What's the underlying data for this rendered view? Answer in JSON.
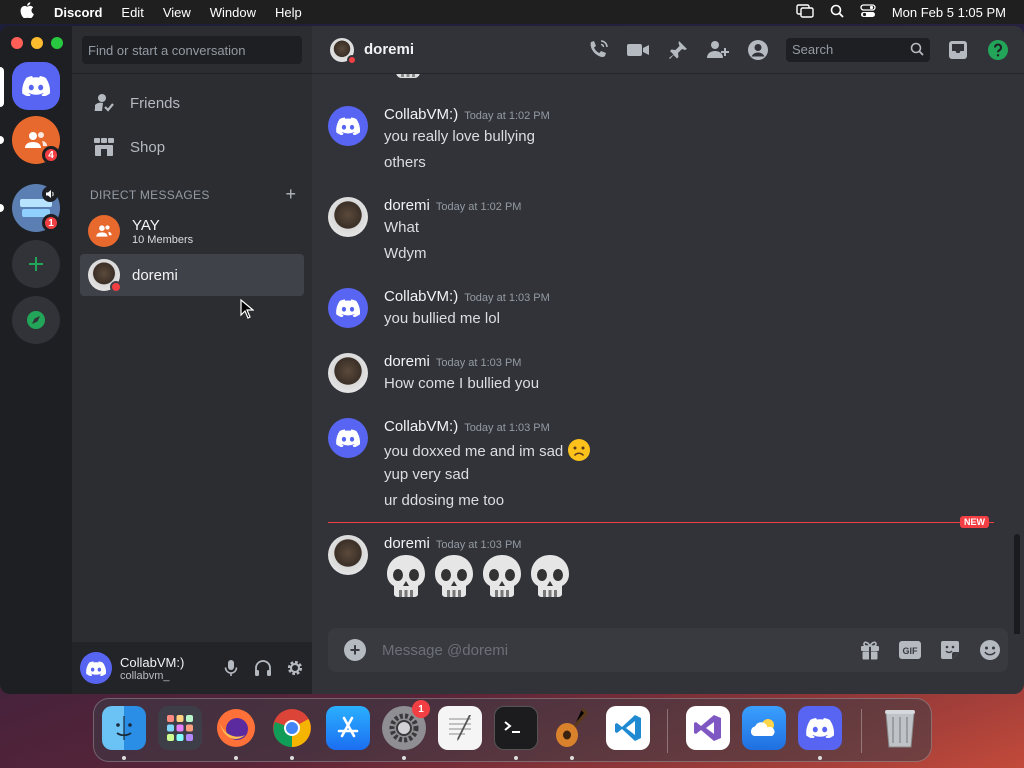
{
  "menubar": {
    "app_name": "Discord",
    "items": [
      "Edit",
      "View",
      "Window",
      "Help"
    ],
    "clock": "Mon Feb 5  1:05 PM"
  },
  "servers": {
    "friends_badge": "4",
    "server_badge": "1"
  },
  "sidebar": {
    "find_placeholder": "Find or start a conversation",
    "friends_label": "Friends",
    "shop_label": "Shop",
    "dm_header": "DIRECT MESSAGES",
    "dms": [
      {
        "name": "YAY",
        "sub": "10 Members"
      },
      {
        "name": "doremi",
        "sub": ""
      }
    ]
  },
  "user_panel": {
    "display_name": "CollabVM:)",
    "username": "collabvm_"
  },
  "topbar": {
    "channel_name": "doremi",
    "search_placeholder": "Search"
  },
  "messages": [
    {
      "author": "CollabVM:)",
      "time": "Today at 1:02 PM",
      "lines": [
        "you really love bullying",
        "others"
      ]
    },
    {
      "author": "doremi",
      "time": "Today at 1:02 PM",
      "lines": [
        "What",
        "Wdym"
      ]
    },
    {
      "author": "CollabVM:)",
      "time": "Today at 1:03 PM",
      "lines": [
        "you bullied me lol"
      ]
    },
    {
      "author": "doremi",
      "time": "Today at 1:03 PM",
      "lines": [
        "How come I bullied you"
      ]
    },
    {
      "author": "CollabVM:)",
      "time": "Today at 1:03 PM",
      "lines": [
        "you doxxed me and im sad",
        "yup very sad",
        "ur ddosing me too"
      ]
    },
    {
      "author": "doremi",
      "time": "Today at 1:03 PM",
      "lines": [
        "💀💀💀💀"
      ]
    }
  ],
  "new_tag": "NEW",
  "composer": {
    "placeholder": "Message @doremi",
    "gif_label": "GIF"
  },
  "dock": {
    "settings_badge": "1"
  },
  "colors": {
    "blurple": "#5865f2",
    "red": "#f23f43",
    "green": "#23a559",
    "bg": "#313338"
  }
}
